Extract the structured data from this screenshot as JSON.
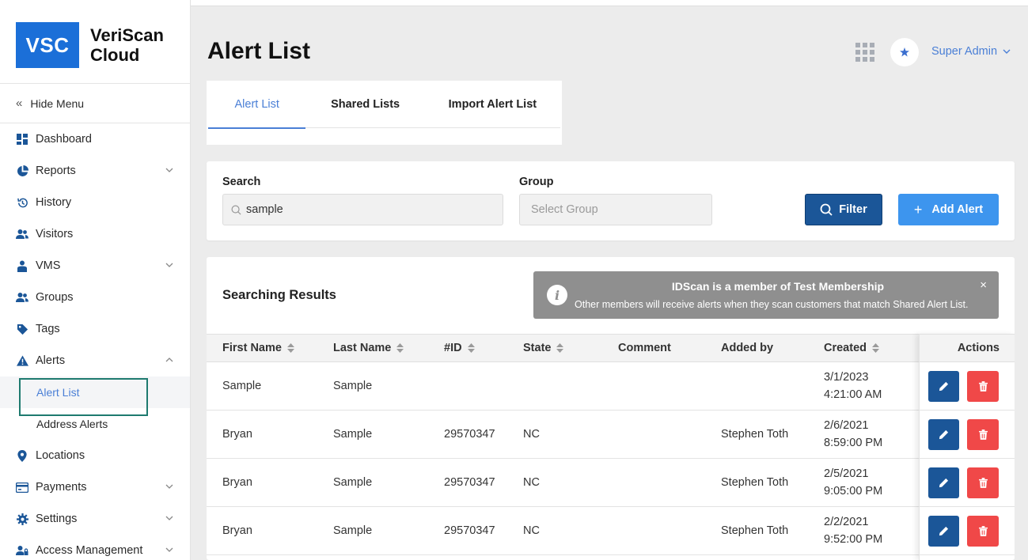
{
  "brand": {
    "logo_abbr": "VSC",
    "logo_line1": "VeriScan",
    "logo_line2": "Cloud"
  },
  "sidebar": {
    "hide_menu": "Hide Menu",
    "items": {
      "dashboard": "Dashboard",
      "reports": "Reports",
      "history": "History",
      "visitors": "Visitors",
      "vms": "VMS",
      "groups": "Groups",
      "tags": "Tags",
      "alerts": "Alerts",
      "alert_list": "Alert List",
      "address_alerts": "Address Alerts",
      "locations": "Locations",
      "payments": "Payments",
      "settings": "Settings",
      "access_management": "Access Management"
    }
  },
  "header": {
    "title": "Alert List",
    "user": "Super Admin"
  },
  "tabs": {
    "alert_list": "Alert List",
    "shared_lists": "Shared Lists",
    "import_alert_list": "Import Alert List"
  },
  "filter": {
    "search_label": "Search",
    "search_value": "sample",
    "group_label": "Group",
    "group_placeholder": "Select Group",
    "filter_button": "Filter",
    "add_button": "Add Alert"
  },
  "results": {
    "title": "Searching Results",
    "notice_title": "IDScan is a member of Test Membership",
    "notice_text": "Other members will receive alerts when they scan customers that match Shared Alert List.",
    "columns": {
      "first_name": "First Name",
      "last_name": "Last Name",
      "id": "#ID",
      "state": "State",
      "comment": "Comment",
      "added_by": "Added by",
      "created": "Created",
      "actions": "Actions"
    },
    "rows": [
      {
        "first": "Sample",
        "last": "Sample",
        "id": "",
        "state": "",
        "comment": "",
        "added_by": "",
        "date": "3/1/2023",
        "time": "4:21:00 AM"
      },
      {
        "first": "Bryan",
        "last": "Sample",
        "id": "29570347",
        "state": "NC",
        "comment": "",
        "added_by": "Stephen Toth",
        "date": "2/6/2021",
        "time": "8:59:00 PM"
      },
      {
        "first": "Bryan",
        "last": "Sample",
        "id": "29570347",
        "state": "NC",
        "comment": "",
        "added_by": "Stephen Toth",
        "date": "2/5/2021",
        "time": "9:05:00 PM"
      },
      {
        "first": "Bryan",
        "last": "Sample",
        "id": "29570347",
        "state": "NC",
        "comment": "",
        "added_by": "Stephen Toth",
        "date": "2/2/2021",
        "time": "9:52:00 PM"
      }
    ]
  },
  "colors": {
    "primary": "#1b5698",
    "accent": "#3d95ee",
    "link": "#4a7fd6",
    "danger": "#f04848",
    "notice": "#8f8f8f"
  }
}
